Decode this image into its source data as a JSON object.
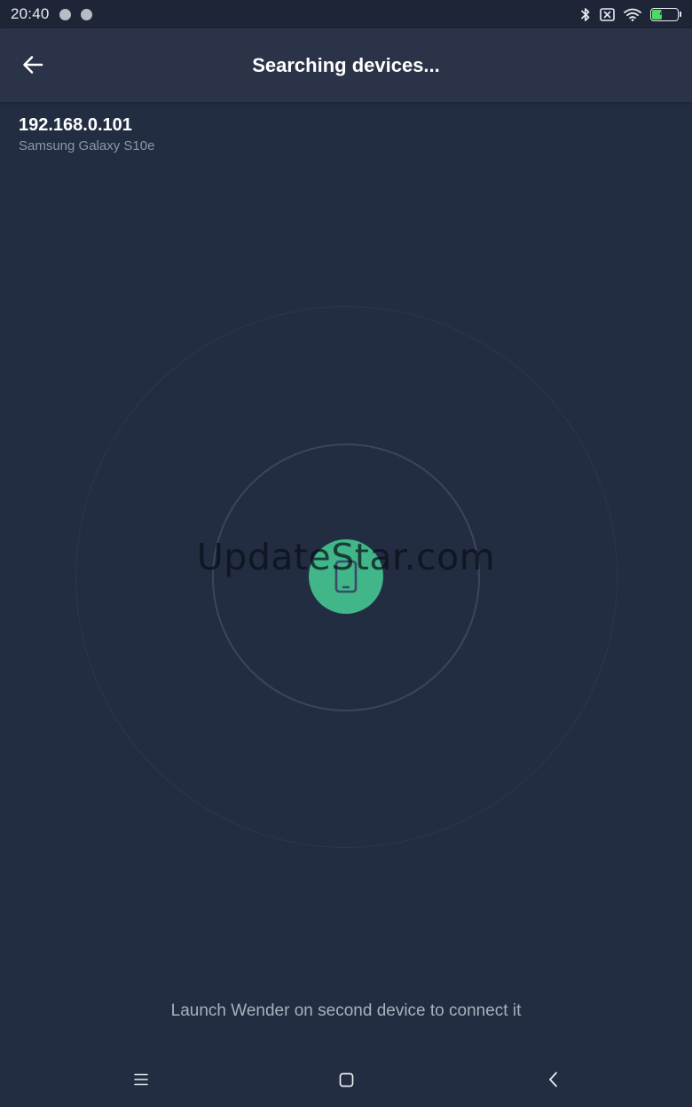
{
  "status_bar": {
    "time": "20:40",
    "battery_level": "44",
    "battery_percent": 44,
    "icons": [
      "notification-dot-icon",
      "notification-dot-icon",
      "bluetooth-icon",
      "no-sim-icon",
      "wifi-icon",
      "battery-icon"
    ]
  },
  "app_bar": {
    "title": "Searching devices...",
    "back_icon": "arrow-left-icon"
  },
  "devices": [
    {
      "ip": "192.168.0.101",
      "name": "Samsung Galaxy S10e"
    }
  ],
  "radar": {
    "center_icon": "smartphone-icon",
    "accent_color": "#41b689"
  },
  "watermark": "UpdateStar.com",
  "hint": "Launch Wender on second device to connect it",
  "navigation": {
    "icons": [
      "menu-icon",
      "home-square-icon",
      "back-chevron-icon"
    ]
  },
  "colors": {
    "background": "#222d42",
    "app_bar": "#2a3348",
    "status_bar": "#1e2537",
    "accent": "#41b689"
  }
}
